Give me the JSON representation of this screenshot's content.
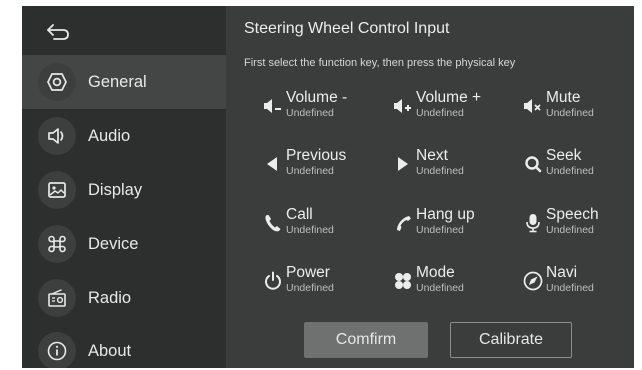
{
  "header": {
    "title": "Steering Wheel Control Input",
    "instruction": "First select the function key, then press the physical key"
  },
  "sidebar": {
    "items": [
      {
        "label": "General",
        "icon": "hexagon-icon",
        "active": true
      },
      {
        "label": "Audio",
        "icon": "speaker-icon",
        "active": false
      },
      {
        "label": "Display",
        "icon": "image-icon",
        "active": false
      },
      {
        "label": "Device",
        "icon": "command-icon",
        "active": false
      },
      {
        "label": "Radio",
        "icon": "radio-icon",
        "active": false
      },
      {
        "label": "About",
        "icon": "info-icon",
        "active": false
      }
    ]
  },
  "function_keys": [
    {
      "name": "Volume -",
      "status": "Undefined",
      "icon": "volume-down-icon"
    },
    {
      "name": "Volume +",
      "status": "Undefined",
      "icon": "volume-up-icon"
    },
    {
      "name": "Mute",
      "status": "Undefined",
      "icon": "mute-icon"
    },
    {
      "name": "Previous",
      "status": "Undefined",
      "icon": "previous-icon"
    },
    {
      "name": "Next",
      "status": "Undefined",
      "icon": "next-icon"
    },
    {
      "name": "Seek",
      "status": "Undefined",
      "icon": "seek-icon"
    },
    {
      "name": "Call",
      "status": "Undefined",
      "icon": "phone-icon"
    },
    {
      "name": "Hang up",
      "status": "Undefined",
      "icon": "hang-up-icon"
    },
    {
      "name": "Speech",
      "status": "Undefined",
      "icon": "microphone-icon"
    },
    {
      "name": "Power",
      "status": "Undefined",
      "icon": "power-icon"
    },
    {
      "name": "Mode",
      "status": "Undefined",
      "icon": "mode-icon"
    },
    {
      "name": "Navi",
      "status": "Undefined",
      "icon": "navigation-icon"
    }
  ],
  "buttons": {
    "confirm": "Comfirm",
    "calibrate": "Calibrate"
  },
  "colors": {
    "panel": "#3b3d3c",
    "sidebar": "#2d2f2e",
    "active_item": "#434645",
    "confirm_button": "#6e7170"
  }
}
